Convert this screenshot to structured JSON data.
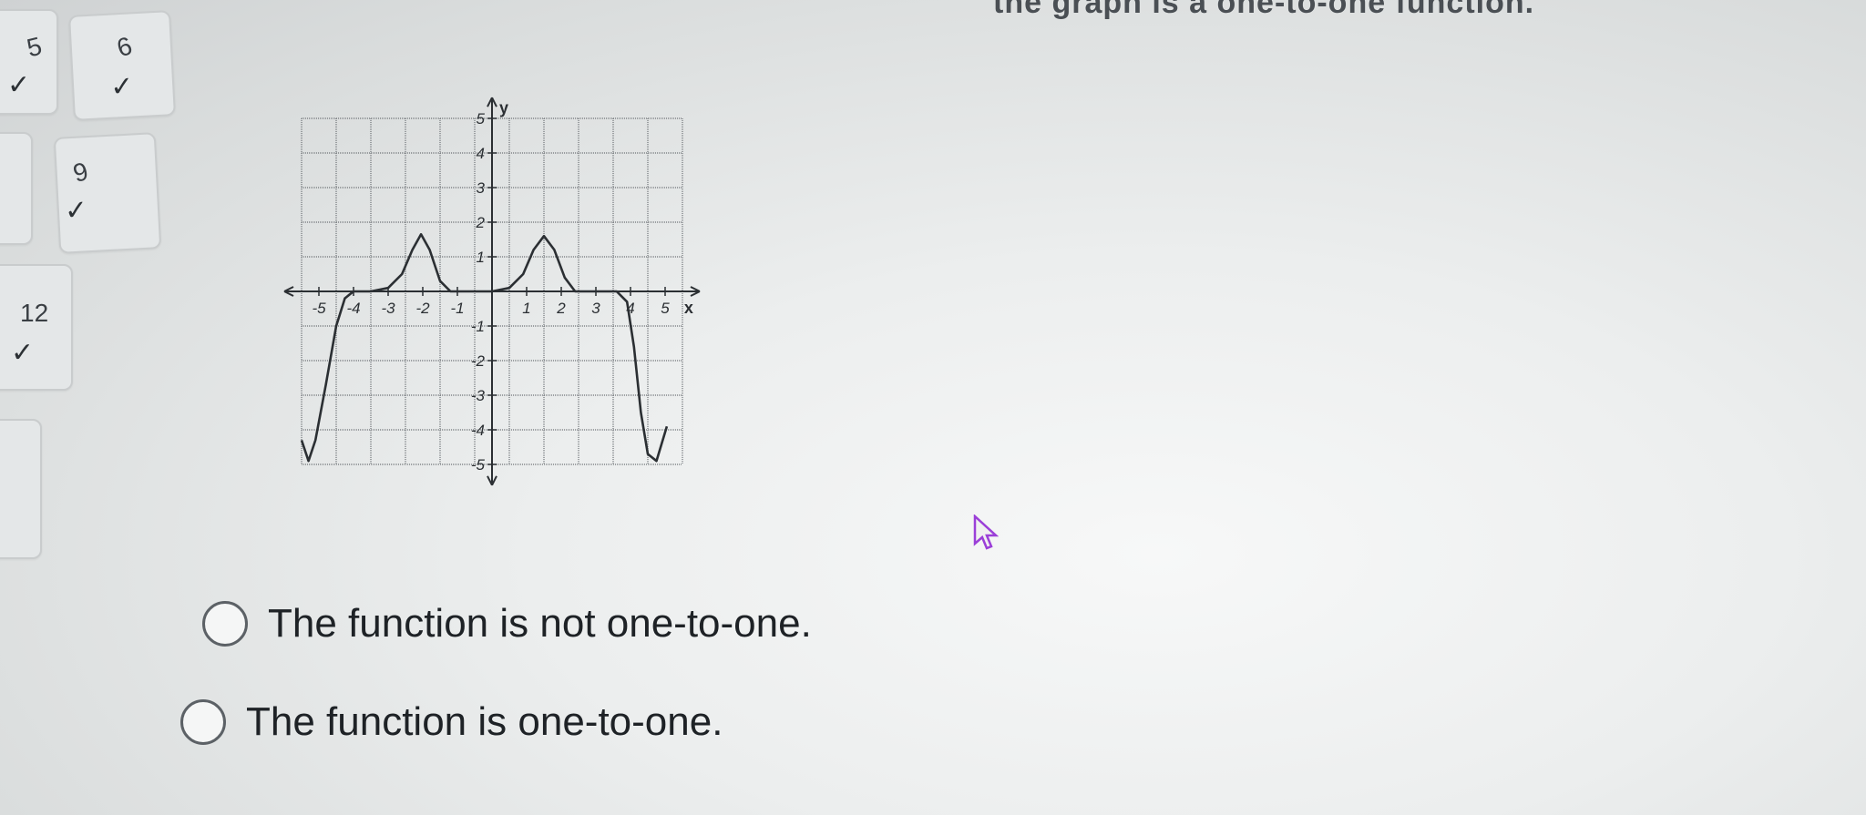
{
  "question": {
    "prompt_visible": "the graph is a one-to-one function."
  },
  "question_nav": {
    "items": [
      {
        "label": "5",
        "status": "answered"
      },
      {
        "label": "6",
        "status": "answered"
      },
      {
        "label": "9",
        "status": "answered"
      },
      {
        "label": "12",
        "status": "answered"
      }
    ],
    "check_glyph": "✓"
  },
  "graph": {
    "x_axis_label": "x",
    "y_axis_label": "y",
    "x_ticks": [
      "-5",
      "-4",
      "-3",
      "-2",
      "-1",
      "1",
      "2",
      "3",
      "4",
      "5"
    ],
    "y_ticks": [
      "5",
      "4",
      "3",
      "2",
      "1",
      "-1",
      "-2",
      "-3",
      "-4",
      "-5"
    ],
    "curve_points": [
      [
        -5.5,
        -4.3
      ],
      [
        -5.3,
        -4.9
      ],
      [
        -5.1,
        -4.3
      ],
      [
        -4.8,
        -2.7
      ],
      [
        -4.5,
        -1.0
      ],
      [
        -4.25,
        -0.2
      ],
      [
        -4.0,
        0.0
      ],
      [
        -3.5,
        0.0
      ],
      [
        -3.0,
        0.1
      ],
      [
        -2.6,
        0.5
      ],
      [
        -2.3,
        1.2
      ],
      [
        -2.05,
        1.65
      ],
      [
        -1.8,
        1.2
      ],
      [
        -1.5,
        0.3
      ],
      [
        -1.2,
        0.0
      ],
      [
        -0.5,
        0.0
      ],
      [
        0,
        0.0
      ],
      [
        0.5,
        0.1
      ],
      [
        0.9,
        0.5
      ],
      [
        1.2,
        1.2
      ],
      [
        1.5,
        1.6
      ],
      [
        1.8,
        1.2
      ],
      [
        2.1,
        0.4
      ],
      [
        2.4,
        0.0
      ],
      [
        3.0,
        0.0
      ],
      [
        3.6,
        0.0
      ],
      [
        3.9,
        -0.3
      ],
      [
        4.1,
        -1.6
      ],
      [
        4.3,
        -3.5
      ],
      [
        4.5,
        -4.7
      ],
      [
        4.75,
        -4.9
      ],
      [
        4.9,
        -4.4
      ],
      [
        5.05,
        -3.9
      ]
    ]
  },
  "answer_options": [
    {
      "id": "opt-not-one-to-one",
      "label": "The function is not one-to-one.",
      "selected": false
    },
    {
      "id": "opt-one-to-one",
      "label": "The function is one-to-one.",
      "selected": false
    }
  ],
  "colors": {
    "accent_text": "#1e2226",
    "grid": "#6f7377",
    "curve": "#2b2f33"
  }
}
